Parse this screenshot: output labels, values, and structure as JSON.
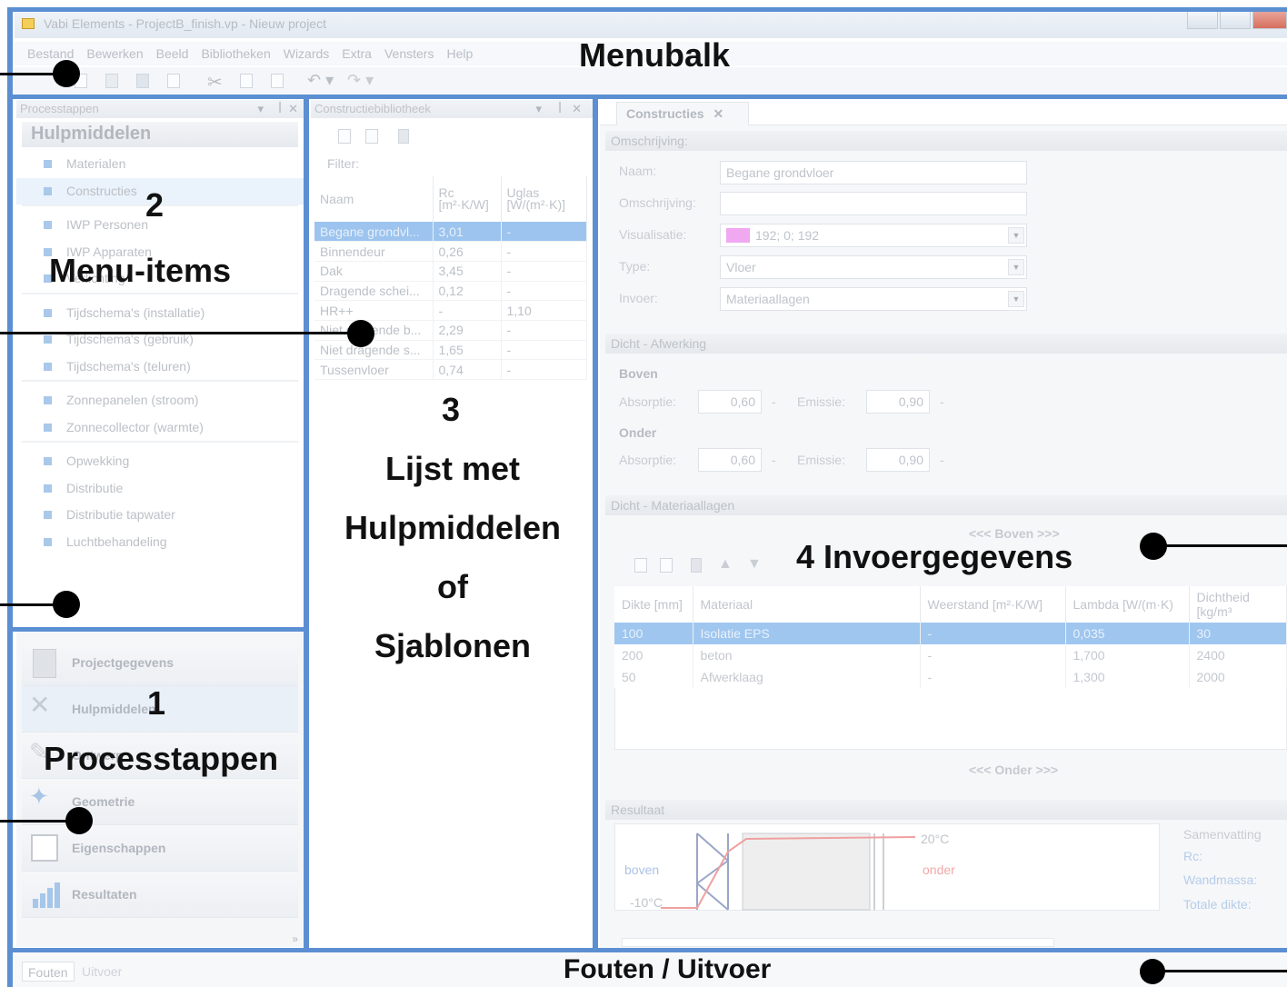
{
  "window": {
    "title": "Vabi Elements - ProjectB_finish.vp - Nieuw project"
  },
  "menubar": {
    "items": [
      "Bestand",
      "Bewerken",
      "Beeld",
      "Bibliotheken",
      "Wizards",
      "Extra",
      "Vensters",
      "Help"
    ]
  },
  "panel2": {
    "header": "Processtappen",
    "title": "Hulpmiddelen",
    "groups": [
      [
        "Materialen",
        "Constructies"
      ],
      [
        "IWP Personen",
        "IWP Apparaten",
        "Verlichting"
      ],
      [
        "Tijdschema's (installatie)",
        "Tijdschema's (gebruik)",
        "Tijdschema's (teluren)"
      ],
      [
        "Zonnepanelen (stroom)",
        "Zonnecollector (warmte)"
      ],
      [
        "Opwekking",
        "Distributie",
        "Distributie tapwater",
        "Luchtbehandeling"
      ]
    ]
  },
  "panel1": {
    "steps": [
      {
        "label": "Projectgegevens",
        "icon": "project-data-icon"
      },
      {
        "label": "Hulpmiddelen",
        "icon": "tools-icon"
      },
      {
        "label": "Ontwerp",
        "icon": "design-icon"
      },
      {
        "label": "Geometrie",
        "icon": "geometry-icon"
      },
      {
        "label": "Eigenschappen",
        "icon": "properties-icon"
      },
      {
        "label": "Resultaten",
        "icon": "results-icon"
      }
    ]
  },
  "panel3": {
    "header": "Constructiebibliotheek",
    "filter_label": "Filter:",
    "columns": [
      "Naam",
      "Rc [m²·K/W]",
      "Uglas [W/(m²·K)]"
    ],
    "rows": [
      [
        "Begane grondvl...",
        "3,01",
        "-"
      ],
      [
        "Binnendeur",
        "0,26",
        "-"
      ],
      [
        "Dak",
        "3,45",
        "-"
      ],
      [
        "Dragende schei...",
        "0,12",
        "-"
      ],
      [
        "HR++",
        "-",
        "1,10"
      ],
      [
        "Niet dragende b...",
        "2,29",
        "-"
      ],
      [
        "Niet dragende s...",
        "1,65",
        "-"
      ],
      [
        "Tussenvloer",
        "0,74",
        "-"
      ]
    ]
  },
  "panel4": {
    "tab": "Constructies",
    "omschrijving": {
      "section": "Omschrijving:",
      "naam_label": "Naam:",
      "naam_value": "Begane grondvloer",
      "omschr_label": "Omschrijving:",
      "omschr_value": "",
      "vis_label": "Visualisatie:",
      "vis_value": "192; 0; 192",
      "vis_color": "#f0a8f0",
      "type_label": "Type:",
      "type_value": "Vloer",
      "invoer_label": "Invoer:",
      "invoer_value": "Materiaallagen"
    },
    "afwerking": {
      "section": "Dicht - Afwerking",
      "boven": "Boven",
      "onder": "Onder",
      "absorptie_label": "Absorptie:",
      "emissie_label": "Emissie:",
      "boven_abs": "0,60",
      "boven_em": "0,90",
      "onder_abs": "0,60",
      "onder_em": "0,90",
      "unit": "-"
    },
    "lagen": {
      "section": "Dicht - Materiaallagen",
      "boven": "<<< Boven >>>",
      "onder": "<<< Onder >>>",
      "columns": [
        "Dikte [mm]",
        "Materiaal",
        "Weerstand [m²·K/W]",
        "Lambda [W/(m·K)",
        "Dichtheid [kg/m³"
      ],
      "rows": [
        [
          "100",
          "Isolatie EPS",
          "-",
          "0,035",
          "30"
        ],
        [
          "200",
          "beton",
          "-",
          "1,700",
          "2400"
        ],
        [
          "50",
          "Afwerklaag",
          "-",
          "1,300",
          "2000"
        ]
      ]
    },
    "resultaat": {
      "section": "Resultaat",
      "boven": "boven",
      "onder": "onder",
      "t_low": "-10°C",
      "t_high": "20°C",
      "summary_title": "Samenvatting",
      "summary_items": [
        "Rc:",
        "Wandmassa:",
        "Totale dikte:"
      ]
    }
  },
  "statusbar": {
    "tabs": [
      "Fouten",
      "Uitvoer"
    ]
  },
  "annotations": {
    "menubalk": "Menubalk",
    "n2": "2",
    "menuitems": "Menu-items",
    "n1": "1",
    "processtappen": "Processtappen",
    "n3": "3",
    "lijst_lines": [
      "Lijst met",
      "Hulpmiddelen",
      "of",
      "Sjablonen"
    ],
    "invoer": "4 Invoergegevens",
    "fouten": "Fouten / Uitvoer"
  }
}
